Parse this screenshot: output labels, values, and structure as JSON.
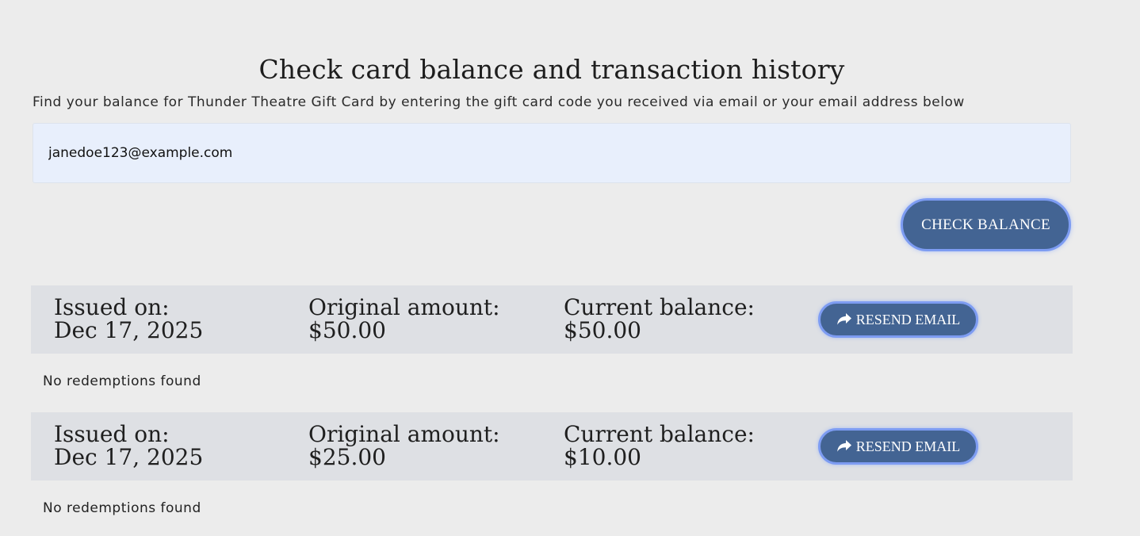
{
  "header": {
    "title": "Check card balance and transaction history",
    "subtitle": "Find your balance for Thunder Theatre Gift Card by entering the gift card code you received via email or your email address below"
  },
  "search": {
    "value": "janedoe123@example.com",
    "check_label": "CHECK BALANCE"
  },
  "cards": [
    {
      "issued_label": "Issued on:",
      "issued_value": "Dec 17, 2025",
      "original_label": "Original amount:",
      "original_value": "$50.00",
      "current_label": "Current balance:",
      "current_value": "$50.00",
      "resend_label": "RESEND EMAIL",
      "resend_icon": "share-arrow-icon",
      "redemptions_text": "No redemptions found"
    },
    {
      "issued_label": "Issued on:",
      "issued_value": "Dec 17, 2025",
      "original_label": "Original amount:",
      "original_value": "$25.00",
      "current_label": "Current balance:",
      "current_value": "$10.00",
      "resend_label": "RESEND EMAIL",
      "resend_icon": "share-arrow-icon",
      "redemptions_text": "No redemptions found"
    }
  ],
  "colors": {
    "background": "#ececec",
    "input_background": "#e8effc",
    "button_fill": "#436493",
    "button_border": "#7d9cf2",
    "card_row_background": "#dee0e4"
  }
}
